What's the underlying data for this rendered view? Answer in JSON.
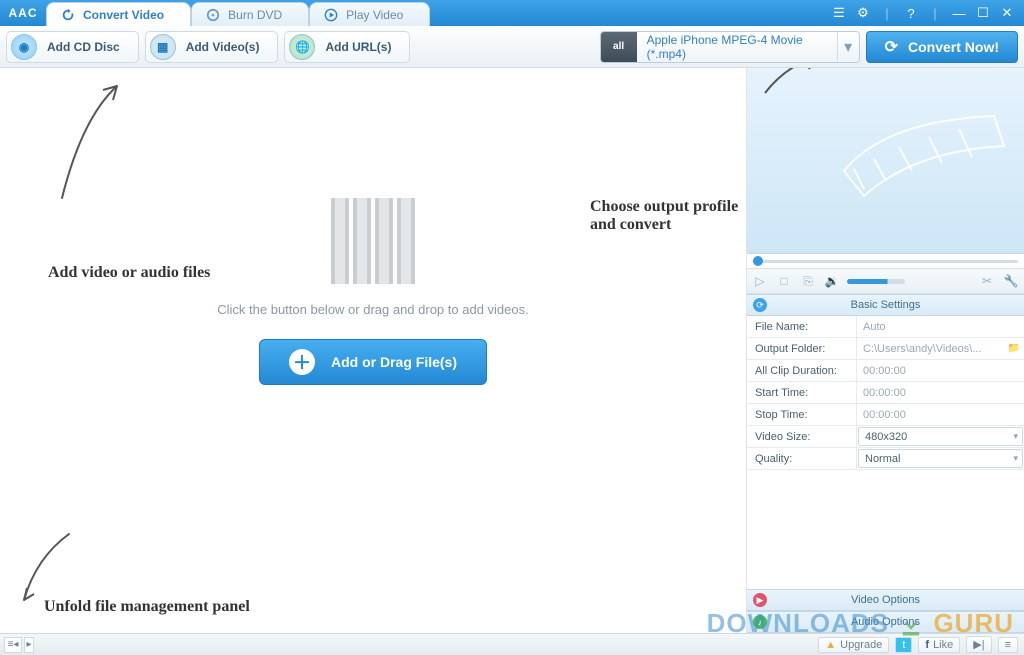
{
  "app": {
    "logo": "AAC"
  },
  "tabs": {
    "convert": "Convert Video",
    "burn": "Burn DVD",
    "play": "Play Video"
  },
  "toolbar": {
    "add_cd": "Add CD Disc",
    "add_videos": "Add Video(s)",
    "add_urls": "Add URL(s)",
    "profile_icon": "all",
    "profile_label": "Apple iPhone MPEG-4 Movie (*.mp4)",
    "convert_now": "Convert Now!"
  },
  "center": {
    "hint": "Click the button below or drag and drop to add videos.",
    "add_button": "Add or Drag File(s)"
  },
  "annotations": {
    "add_files": "Add video or audio files",
    "choose_profile": "Choose output profile and convert",
    "unfold": "Unfold file management panel"
  },
  "settings": {
    "basic_header": "Basic Settings",
    "rows": {
      "file_name_k": "File Name:",
      "file_name_v": "Auto",
      "output_folder_k": "Output Folder:",
      "output_folder_v": "C:\\Users\\andy\\Videos\\...",
      "all_clip_k": "All Clip Duration:",
      "all_clip_v": "00:00:00",
      "start_time_k": "Start Time:",
      "start_time_v": "00:00:00",
      "stop_time_k": "Stop Time:",
      "stop_time_v": "00:00:00",
      "video_size_k": "Video Size:",
      "video_size_v": "480x320",
      "quality_k": "Quality:",
      "quality_v": "Normal"
    },
    "video_options": "Video Options",
    "audio_options": "Audio Options"
  },
  "statusbar": {
    "upgrade": "Upgrade",
    "like": "Like"
  },
  "watermark": {
    "a": "DOWNLOADS",
    "b": "GURU"
  }
}
